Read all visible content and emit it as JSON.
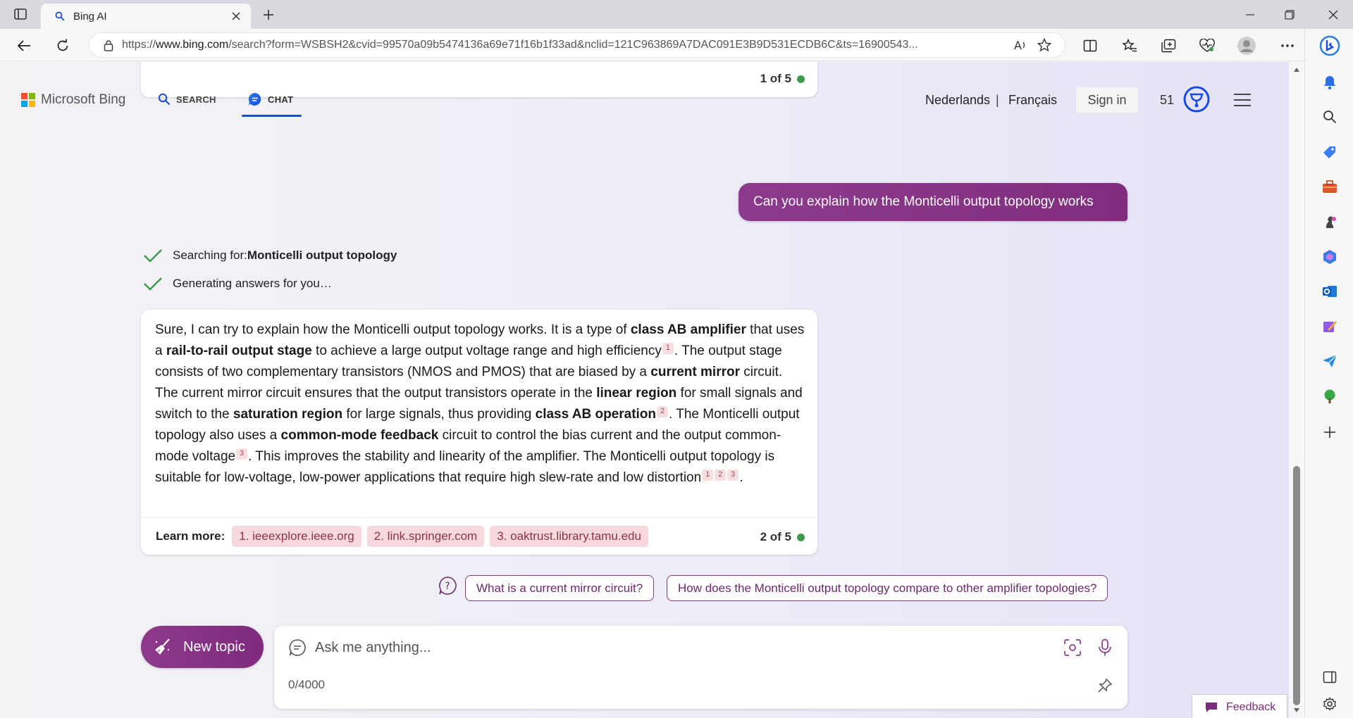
{
  "browser": {
    "tab_title": "Bing AI",
    "url_prefix": "https://",
    "url_host": "www.bing.com",
    "url_rest": "/search?form=WSBSH2&cvid=99570a09b5474136a69e71f16b1f33ad&nclid=121C963869A7DAC091E3B9D531ECDB6C&ts=16900543..."
  },
  "header": {
    "brand": "Microsoft Bing",
    "nav_search": "SEARCH",
    "nav_chat": "CHAT",
    "lang_1": "Nederlands",
    "lang_sep": "|",
    "lang_2": "Français",
    "sign_in": "Sign in",
    "points": "51"
  },
  "chat": {
    "card1_counter": "1 of 5",
    "user_message": "Can you explain how the Monticelli output topology works",
    "status_searching_prefix": "Searching for: ",
    "status_searching_query": "Monticelli output topology",
    "status_generating": "Generating answers for you…",
    "answer": {
      "p1": "Sure, I can try to explain how the Monticelli output topology works. It is a type of ",
      "b1": "class AB amplifier",
      "p2": " that uses a ",
      "b2": "rail-to-rail output stage",
      "p3": " to achieve a large output voltage range and high efficiency",
      "c1": "1",
      "p4": ". The output stage consists of two complementary transistors (NMOS and PMOS) that are biased by a ",
      "b3": "current mirror",
      "p5": " circuit. The current mirror circuit ensures that the output transistors operate in the ",
      "b4": "linear region",
      "p6": " for small signals and switch to the ",
      "b5": "saturation region",
      "p7": " for large signals, thus providing ",
      "b6": "class AB operation",
      "c2": "2",
      "p8": ". The Monticelli output topology also uses a ",
      "b7": "common-mode feedback",
      "p9": " circuit to control the bias current and the output common-mode voltage",
      "c3": "3",
      "p10": ". This improves the stability and linearity of the amplifier. The Monticelli output topology is suitable for low-voltage, low-power applications that require high slew-rate and low distortion",
      "c4": "1",
      "c5": "2",
      "c6": "3",
      "p11": "."
    },
    "learn_more_label": "Learn more:",
    "sources": [
      "1. ieeexplore.ieee.org",
      "2. link.springer.com",
      "3. oaktrust.library.tamu.edu"
    ],
    "card2_counter": "2 of 5",
    "suggestions": [
      "What is a current mirror circuit?",
      "How does the Monticelli output topology compare to other amplifier topologies?"
    ],
    "new_topic": "New topic",
    "input_placeholder": "Ask me anything...",
    "char_count": "0/4000",
    "feedback": "Feedback"
  },
  "colors": {
    "accent_purple": "#8c3a8c",
    "chat_blue": "#174ae4",
    "status_green": "#3e9a4d",
    "citation_bg": "#f7dfe1"
  },
  "icons": [
    "window-icon",
    "search-icon",
    "close-icon",
    "plus-icon",
    "minimize-icon",
    "maximize-icon",
    "back-icon",
    "refresh-icon",
    "lock-icon",
    "read-aloud-icon",
    "star-icon",
    "split-screen-icon",
    "favorites-icon",
    "collections-icon",
    "performance-icon",
    "profile-icon",
    "more-icon",
    "bing-chat-icon",
    "check-icon",
    "question-icon",
    "broom-icon",
    "chat-icon",
    "visual-search-icon",
    "mic-icon",
    "pin-icon",
    "feedback-icon",
    "bell-icon",
    "tag-icon",
    "toolbox-icon",
    "chess-icon",
    "office-icon",
    "outlook-icon",
    "designer-icon",
    "send-icon",
    "tree-icon",
    "sidebar-toggle-icon",
    "settings-icon"
  ]
}
